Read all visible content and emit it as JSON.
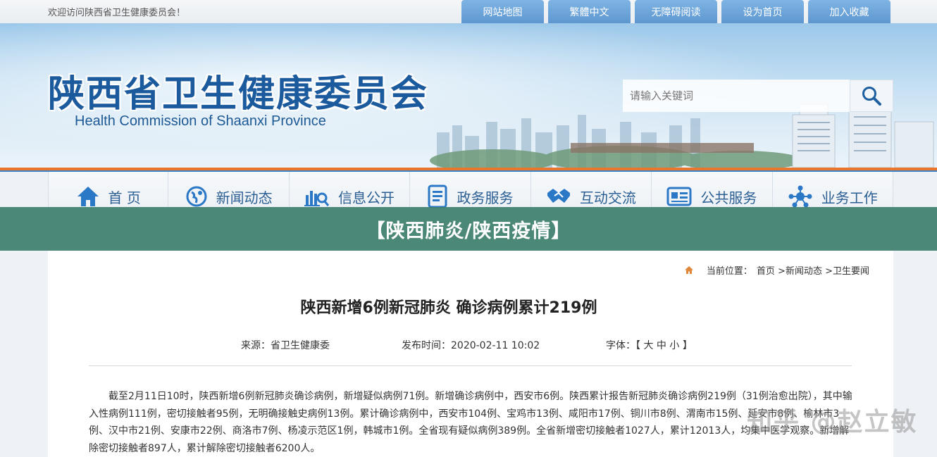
{
  "topbar": {
    "welcome": "欢迎访问陕西省卫生健康委员会！",
    "links": [
      "网站地图",
      "繁體中文",
      "无障碍阅读",
      "设为首页",
      "加入收藏"
    ]
  },
  "banner": {
    "title_cn": "陕西省卫生健康委员会",
    "title_en": "Health Commission of Shaanxi Province",
    "search_placeholder": "请输入关键词"
  },
  "nav": {
    "items": [
      {
        "label": "首 页",
        "icon": "home-icon"
      },
      {
        "label": "新闻动态",
        "icon": "globe-icon"
      },
      {
        "label": "信息公开",
        "icon": "chart-search-icon"
      },
      {
        "label": "政务服务",
        "icon": "document-icon"
      },
      {
        "label": "互动交流",
        "icon": "handshake-icon"
      },
      {
        "label": "公共服务",
        "icon": "card-icon"
      },
      {
        "label": "业务工作",
        "icon": "network-icon"
      }
    ]
  },
  "overlay": {
    "text": "【陕西肺炎/陕西疫情】"
  },
  "breadcrumb": {
    "prefix": "当前位置：",
    "items": [
      "首页",
      ">新闻动态",
      ">卫生要闻"
    ]
  },
  "article": {
    "title": "陕西新增6例新冠肺炎 确诊病例累计219例",
    "source": "来源：省卫生健康委",
    "published": "发布时间：2020-02-11 10:02",
    "font_label": "字体：【",
    "font_sizes": [
      "大",
      "中",
      "小"
    ],
    "font_close": "】",
    "body": "截至2月11日10时，陕西新增6例新冠肺炎确诊病例，新增疑似病例71例。新增确诊病例中，西安市6例。陕西累计报告新冠肺炎确诊病例219例（31例治愈出院），其中输入性病例111例，密切接触者95例，无明确接触史病例13例。累计确诊病例中，西安市104例、宝鸡市13例、咸阳市17例、铜川市8例、渭南市15例、延安市8例、榆林市3例、汉中市21例、安康市22例、商洛市7例、杨凌示范区1例，韩城市1例。全省现有疑似病例389例。全省新增密切接触者1027人，累计12013人，均集中医学观察。新增解除密切接触者897人，累计解除密切接触者6200人。"
  },
  "watermark": "知乎 @赵立敏",
  "colors": {
    "accent_orange": "#e9762a",
    "nav_blue": "#2b5f93",
    "overlay_green": "#3e7f6b"
  }
}
